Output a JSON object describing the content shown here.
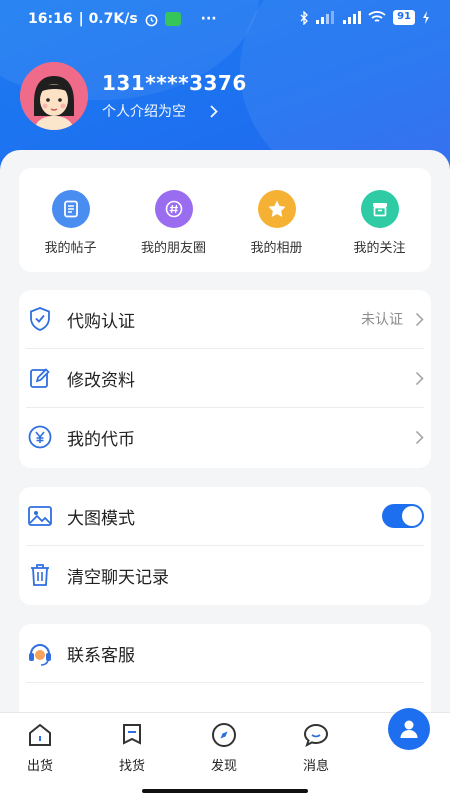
{
  "status_bar": {
    "time": "16:16",
    "speed": "| 0.7K/s",
    "more": "···",
    "battery": "91"
  },
  "profile": {
    "phone": "131****3376",
    "bio": "个人介绍为空"
  },
  "quick_actions": [
    {
      "label": "我的帖子",
      "icon": "document-icon",
      "color": "#4a8df0"
    },
    {
      "label": "我的朋友圈",
      "icon": "hashtag-icon",
      "color": "#9a6cf0"
    },
    {
      "label": "我的相册",
      "icon": "star-icon",
      "color": "#f5b133"
    },
    {
      "label": "我的关注",
      "icon": "archive-icon",
      "color": "#2ecba5"
    }
  ],
  "account_menu": [
    {
      "label": "代购认证",
      "status": "未认证",
      "icon": "shield-check-icon"
    },
    {
      "label": "修改资料",
      "status": "",
      "icon": "edit-icon"
    },
    {
      "label": "我的代币",
      "status": "",
      "icon": "yen-icon"
    }
  ],
  "settings_menu": [
    {
      "label": "大图模式",
      "icon": "image-icon",
      "toggle": true
    },
    {
      "label": "清空聊天记录",
      "icon": "trash-icon"
    }
  ],
  "service_menu": [
    {
      "label": "联系客服",
      "icon": "headset-icon"
    }
  ],
  "tabs": [
    {
      "label": "出货",
      "icon": "house-icon"
    },
    {
      "label": "找货",
      "icon": "bookmark-icon"
    },
    {
      "label": "发现",
      "icon": "compass-icon"
    },
    {
      "label": "消息",
      "icon": "chat-icon"
    }
  ],
  "accent_color": "#1e6ff0"
}
